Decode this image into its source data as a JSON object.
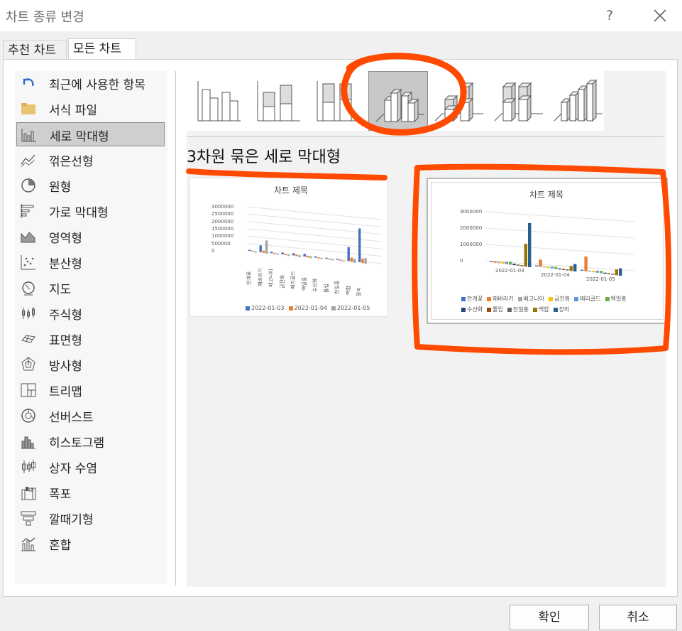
{
  "window": {
    "title": "차트 종류 변경",
    "help_label": "?",
    "close_label": "close"
  },
  "tabs": [
    {
      "label": "추천 차트"
    },
    {
      "label": "모든 차트"
    }
  ],
  "sidebar": {
    "selected_index": 2,
    "items": [
      {
        "label": "최근에 사용한 항목",
        "icon": "undo-arrow-icon"
      },
      {
        "label": "서식 파일",
        "icon": "folder-icon"
      },
      {
        "label": "세로 막대형",
        "icon": "column-chart-icon"
      },
      {
        "label": "꺾은선형",
        "icon": "line-chart-icon"
      },
      {
        "label": "원형",
        "icon": "pie-chart-icon"
      },
      {
        "label": "가로 막대형",
        "icon": "bar-chart-icon"
      },
      {
        "label": "영역형",
        "icon": "area-chart-icon"
      },
      {
        "label": "분산형",
        "icon": "scatter-chart-icon"
      },
      {
        "label": "지도",
        "icon": "map-globe-icon"
      },
      {
        "label": "주식형",
        "icon": "stock-chart-icon"
      },
      {
        "label": "표면형",
        "icon": "surface-chart-icon"
      },
      {
        "label": "방사형",
        "icon": "radar-chart-icon"
      },
      {
        "label": "트리맵",
        "icon": "treemap-icon"
      },
      {
        "label": "선버스트",
        "icon": "sunburst-icon"
      },
      {
        "label": "히스토그램",
        "icon": "histogram-icon"
      },
      {
        "label": "상자 수염",
        "icon": "box-whisker-icon"
      },
      {
        "label": "폭포",
        "icon": "waterfall-icon"
      },
      {
        "label": "깔때기형",
        "icon": "funnel-icon"
      },
      {
        "label": "혼합",
        "icon": "combo-chart-icon"
      }
    ]
  },
  "subtypes": {
    "selected_index": 3,
    "items": [
      {
        "icon": "clustered-column-icon"
      },
      {
        "icon": "stacked-column-icon"
      },
      {
        "icon": "100-stacked-column-icon"
      },
      {
        "icon": "3d-clustered-column-icon"
      },
      {
        "icon": "3d-stacked-column-icon"
      },
      {
        "icon": "3d-100-stacked-column-icon"
      },
      {
        "icon": "3d-column-icon"
      }
    ]
  },
  "selected_subtype_name": "3차원 묶은 세로 막대형",
  "preview1": {
    "title": "차트 제목",
    "yticks": [
      "3000000",
      "2500000",
      "2000000",
      "1500000",
      "1000000",
      "500000",
      "0"
    ],
    "categories": [
      "안개꽃",
      "해바라기",
      "베고니아",
      "금잔화",
      "메리골드",
      "백일홍",
      "수선화",
      "튤립",
      "천일홍",
      "백합",
      "장미"
    ],
    "legend": [
      "2022-01-03",
      "2022-01-04",
      "2022-01-05"
    ]
  },
  "preview2": {
    "title": "차트 제목",
    "yticks": [
      "3000000",
      "2000000",
      "1000000",
      "0"
    ],
    "xlabels": [
      "2022-01-03",
      "2022-01-04",
      "2022-01-05"
    ],
    "legend_row1": [
      "안개꽃",
      "해바라기",
      "베고니아",
      "금잔화",
      "메리골드",
      "백일홍"
    ],
    "legend_row2": [
      "수선화",
      "튤립",
      "천일홍",
      "백합",
      "장미"
    ]
  },
  "colors": {
    "series": [
      "#4472c4",
      "#ed7d31",
      "#a5a5a5",
      "#ffc000",
      "#5b9bd5",
      "#70ad47",
      "#264478",
      "#9e480e",
      "#636363",
      "#997300",
      "#255e91"
    ],
    "selection": "#c8c8c8",
    "annotation": "#ff4a00"
  },
  "buttons": {
    "ok": "확인",
    "cancel": "취소"
  },
  "chart_data": [
    {
      "type": "bar",
      "title": "차트 제목",
      "categories": [
        "안개꽃",
        "해바라기",
        "베고니아",
        "금잔화",
        "메리골드",
        "백일홍",
        "수선화",
        "튤립",
        "천일홍",
        "백합",
        "장미"
      ],
      "series": [
        {
          "name": "2022-01-03",
          "values": [
            10000,
            450000,
            100000,
            120000,
            150000,
            180000,
            90000,
            30000,
            20000,
            950000,
            2300000
          ]
        },
        {
          "name": "2022-01-04",
          "values": [
            5000,
            150000,
            60000,
            80000,
            110000,
            120000,
            50000,
            20000,
            10000,
            300000,
            300000
          ]
        },
        {
          "name": "2022-01-05",
          "values": [
            15000,
            900000,
            70000,
            90000,
            120000,
            140000,
            60000,
            25000,
            15000,
            280000,
            400000
          ]
        }
      ],
      "ylim": [
        0,
        3000000
      ]
    },
    {
      "type": "bar",
      "title": "차트 제목",
      "categories": [
        "2022-01-03",
        "2022-01-04",
        "2022-01-05"
      ],
      "series": [
        {
          "name": "안개꽃",
          "values": [
            10000,
            5000,
            15000
          ]
        },
        {
          "name": "해바라기",
          "values": [
            100000,
            450000,
            900000
          ]
        },
        {
          "name": "베고니아",
          "values": [
            100000,
            60000,
            70000
          ]
        },
        {
          "name": "금잔화",
          "values": [
            120000,
            80000,
            90000
          ]
        },
        {
          "name": "메리골드",
          "values": [
            150000,
            110000,
            120000
          ]
        },
        {
          "name": "백일홍",
          "values": [
            180000,
            120000,
            140000
          ]
        },
        {
          "name": "수선화",
          "values": [
            90000,
            50000,
            60000
          ]
        },
        {
          "name": "튤립",
          "values": [
            30000,
            20000,
            25000
          ]
        },
        {
          "name": "천일홍",
          "values": [
            20000,
            10000,
            15000
          ]
        },
        {
          "name": "백합",
          "values": [
            1400000,
            300000,
            350000
          ]
        },
        {
          "name": "장미",
          "values": [
            2700000,
            450000,
            450000
          ]
        }
      ],
      "ylim": [
        0,
        3000000
      ]
    }
  ]
}
